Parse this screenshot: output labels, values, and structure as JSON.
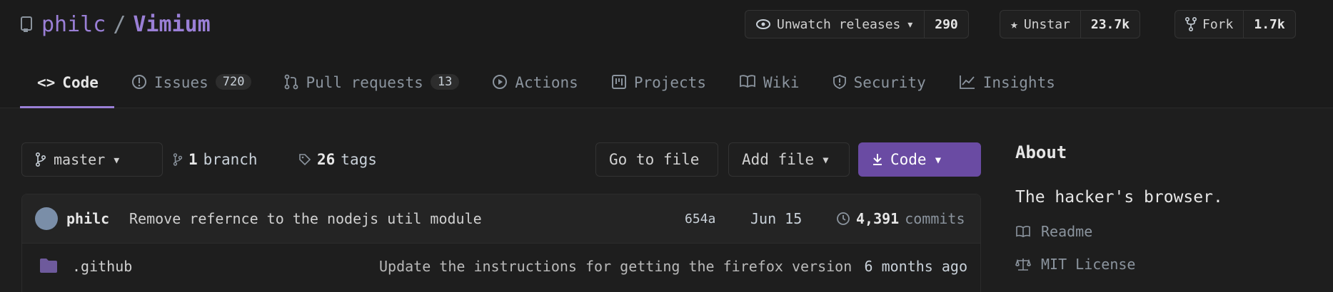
{
  "repo": {
    "owner": "philc",
    "name": "Vimium",
    "separator": "/"
  },
  "header": {
    "watch": {
      "label": "Unwatch releases",
      "count": "290"
    },
    "star": {
      "label": "Unstar",
      "count": "23.7k"
    },
    "fork": {
      "label": "Fork",
      "count": "1.7k"
    }
  },
  "tabs": [
    {
      "label": "Code",
      "icon": "code-icon"
    },
    {
      "label": "Issues",
      "badge": "720",
      "icon": "issue-icon"
    },
    {
      "label": "Pull requests",
      "badge": "13",
      "icon": "pull-request-icon"
    },
    {
      "label": "Actions",
      "icon": "play-icon"
    },
    {
      "label": "Projects",
      "icon": "project-icon"
    },
    {
      "label": "Wiki",
      "icon": "book-icon"
    },
    {
      "label": "Security",
      "icon": "shield-icon"
    },
    {
      "label": "Insights",
      "icon": "graph-icon"
    }
  ],
  "toolbar": {
    "branch": "master",
    "branches_count": "1",
    "branches_label": "branch",
    "tags_count": "26",
    "tags_label": "tags",
    "go_to_file": "Go to file",
    "add_file": "Add file",
    "code": "Code"
  },
  "latest_commit": {
    "author": "philc",
    "message": "Remove refernce to the nodejs util module",
    "hash": "654a",
    "date": "Jun 15",
    "count": "4,391",
    "count_label": "commits"
  },
  "files": [
    {
      "name": ".github",
      "message": "Update the instructions for getting the firefox version",
      "age": "6 months ago"
    }
  ],
  "about": {
    "title": "About",
    "description": "The hacker's browser.",
    "links": [
      {
        "label": "Readme",
        "icon": "book-icon"
      },
      {
        "label": "MIT License",
        "icon": "law-icon"
      }
    ]
  },
  "colors": {
    "accent": "#9a7fd6",
    "code_button": "#6a4ba3",
    "background": "#1e1e1e"
  }
}
